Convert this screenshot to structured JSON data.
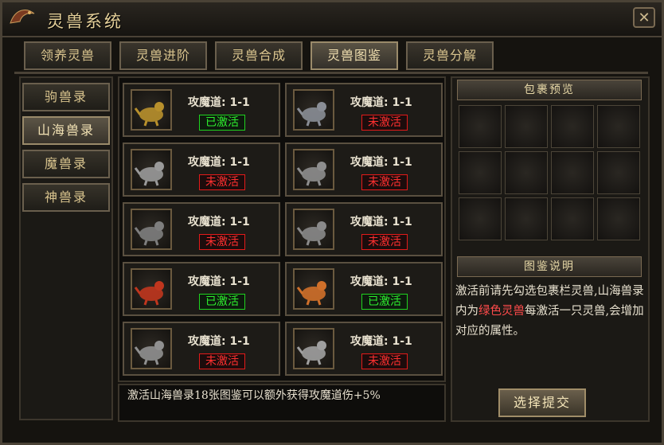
{
  "window": {
    "title": "灵兽系统"
  },
  "tabs": [
    {
      "label": "领养灵兽"
    },
    {
      "label": "灵兽进阶"
    },
    {
      "label": "灵兽合成"
    },
    {
      "label": "灵兽图鉴",
      "active": true
    },
    {
      "label": "灵兽分解"
    }
  ],
  "sidebar": [
    {
      "label": "驹兽录"
    },
    {
      "label": "山海兽录",
      "active": true
    },
    {
      "label": "魔兽录"
    },
    {
      "label": "神兽录"
    }
  ],
  "cards": [
    {
      "title": "攻魔道: 1-1",
      "status": "已激活",
      "active": true,
      "beast": "gold-dragon"
    },
    {
      "title": "攻魔道: 1-1",
      "status": "未激活",
      "active": false,
      "beast": "armored-wolf"
    },
    {
      "title": "攻魔道: 1-1",
      "status": "未激活",
      "active": false,
      "beast": "gray-beast"
    },
    {
      "title": "攻魔道: 1-1",
      "status": "未激活",
      "active": false,
      "beast": "gray-lion"
    },
    {
      "title": "攻魔道: 1-1",
      "status": "未激活",
      "active": false,
      "beast": "gray-demon"
    },
    {
      "title": "攻魔道: 1-1",
      "status": "未激活",
      "active": false,
      "beast": "gray-hound"
    },
    {
      "title": "攻魔道: 1-1",
      "status": "已激活",
      "active": true,
      "beast": "red-lion"
    },
    {
      "title": "攻魔道: 1-1",
      "status": "已激活",
      "active": true,
      "beast": "fire-bird"
    },
    {
      "title": "攻魔道: 1-1",
      "status": "未激活",
      "active": false,
      "beast": "gray-boar"
    },
    {
      "title": "攻魔道: 1-1",
      "status": "未激活",
      "active": false,
      "beast": "gray-eagle"
    }
  ],
  "bottom_text": "激活山海兽录18张图鉴可以额外获得攻魔道伤+5%",
  "inventory": {
    "title": "包裹预览"
  },
  "description": {
    "title": "图鉴说明",
    "part1": "激活前请先勾选包裹栏灵兽,山海兽录内为",
    "highlight": "绿色灵兽",
    "part2": "每激活一只灵兽,会增加对应的属性。"
  },
  "submit_label": "选择提交",
  "colors": {
    "activated": "#2ef02e",
    "not_activated": "#ff3030",
    "highlight": "#ff4b4b",
    "gold": "#e6d19a"
  }
}
